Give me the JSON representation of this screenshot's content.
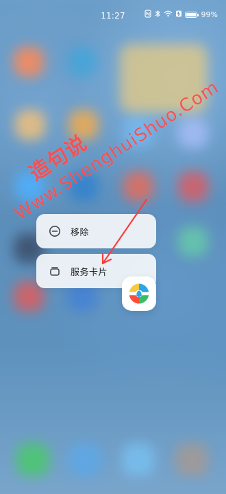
{
  "status_bar": {
    "time": "11:27",
    "icons": [
      "nfc-icon",
      "bluetooth-icon",
      "wifi-icon",
      "battery-saver-icon",
      "battery-icon"
    ],
    "battery_percent": "99%"
  },
  "context_menu": {
    "items": [
      {
        "label": "移除",
        "icon": "remove-circle-icon"
      },
      {
        "label": "服务卡片",
        "icon": "service-card-icon"
      }
    ]
  },
  "focused_app": {
    "icon": "app-logo-icon",
    "colors": {
      "primary": "#2aa7e8",
      "secondary": "#35c062",
      "accent": "#ff4d3a",
      "yellow": "#f6c945"
    }
  },
  "watermark": {
    "cjk": "造句说",
    "url": "Www.ShenghuiShuo.Com"
  },
  "colors": {
    "menu_background": "#f5f7fa",
    "watermark": "#ff4141"
  }
}
